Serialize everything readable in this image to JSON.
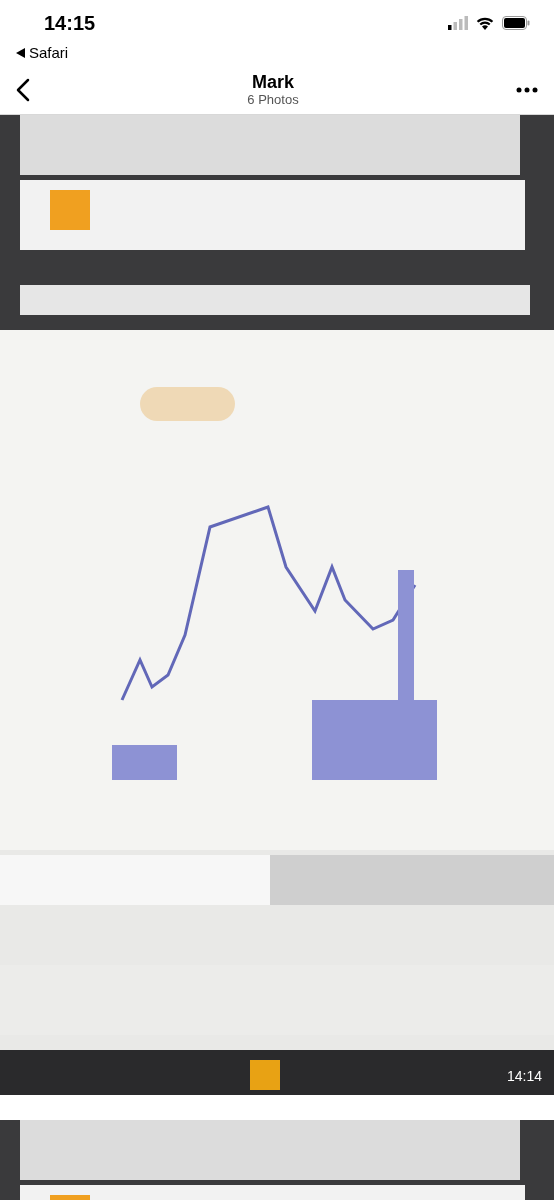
{
  "status_bar": {
    "time": "14:15",
    "back_app": "Safari"
  },
  "nav": {
    "title": "Mark",
    "subtitle": "6 Photos"
  },
  "photos": [
    {
      "kind": "picture",
      "timestamp": "14:14"
    },
    {
      "kind": "picture"
    }
  ]
}
